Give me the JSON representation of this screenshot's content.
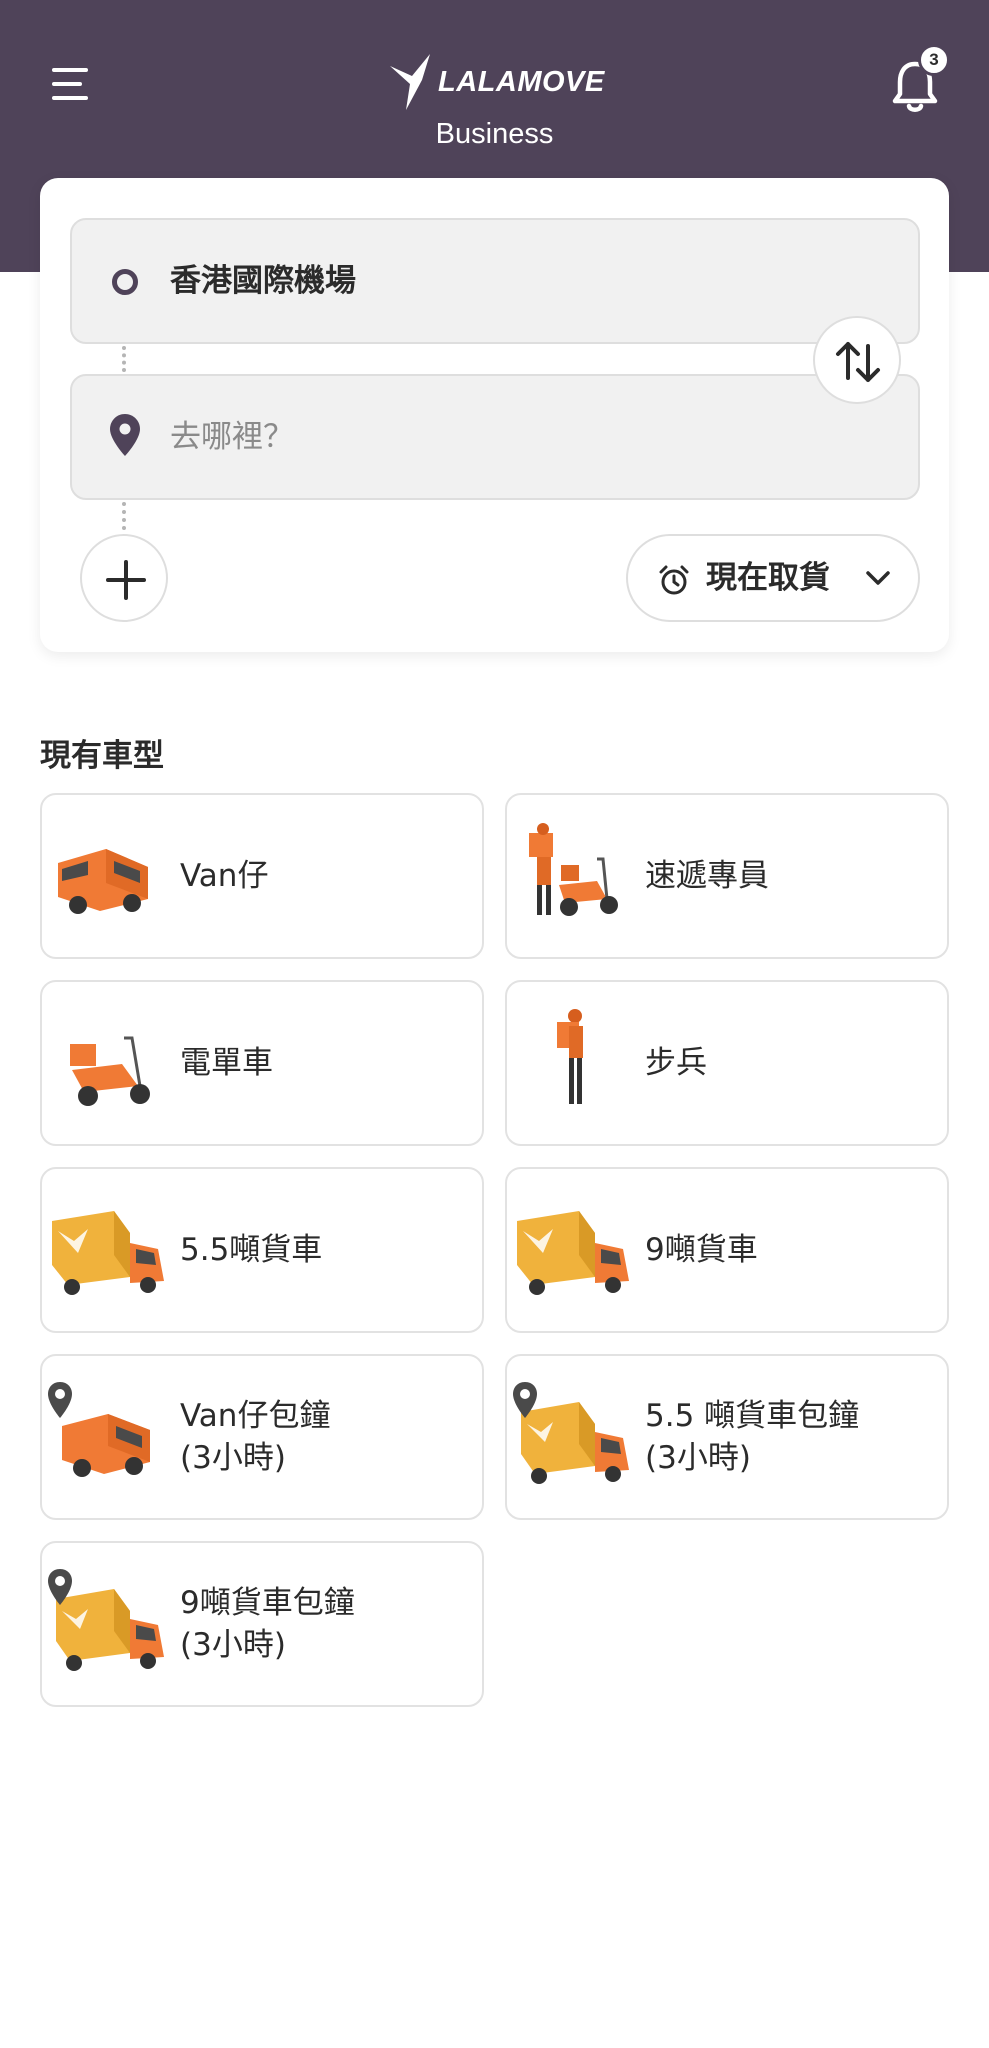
{
  "header": {
    "logo_text": "LALAMOVE",
    "subtitle": "Business",
    "notification_count": "3"
  },
  "route": {
    "pickup": "香港國際機場",
    "dropoff_placeholder": "去哪裡？",
    "time_label": "現在取貨"
  },
  "section_title": "現有車型",
  "vehicles": [
    {
      "line1": "Van仔",
      "line2": "",
      "icon": "van-icon"
    },
    {
      "line1": "速遞專員",
      "line2": "",
      "icon": "courier-scooter-icon"
    },
    {
      "line1": "電單車",
      "line2": "",
      "icon": "motorcycle-icon"
    },
    {
      "line1": "步兵",
      "line2": "",
      "icon": "walker-icon"
    },
    {
      "line1": "5.5噸貨車",
      "line2": "",
      "icon": "truck-icon"
    },
    {
      "line1": "9噸貨車",
      "line2": "",
      "icon": "truck-icon"
    },
    {
      "line1": "Van仔包鐘",
      "line2": "(3小時)",
      "icon": "van-hourly-icon"
    },
    {
      "line1": "5.5 噸貨車包鐘",
      "line2": "(3小時)",
      "icon": "truck-hourly-icon"
    },
    {
      "line1": "9噸貨車包鐘",
      "line2": "(3小時)",
      "icon": "truck-hourly-icon"
    }
  ],
  "colors": {
    "header_bg": "#4f4359",
    "accent_orange": "#f07a35",
    "truck_yellow": "#f0b23c",
    "card_border": "#e2e2e2"
  }
}
